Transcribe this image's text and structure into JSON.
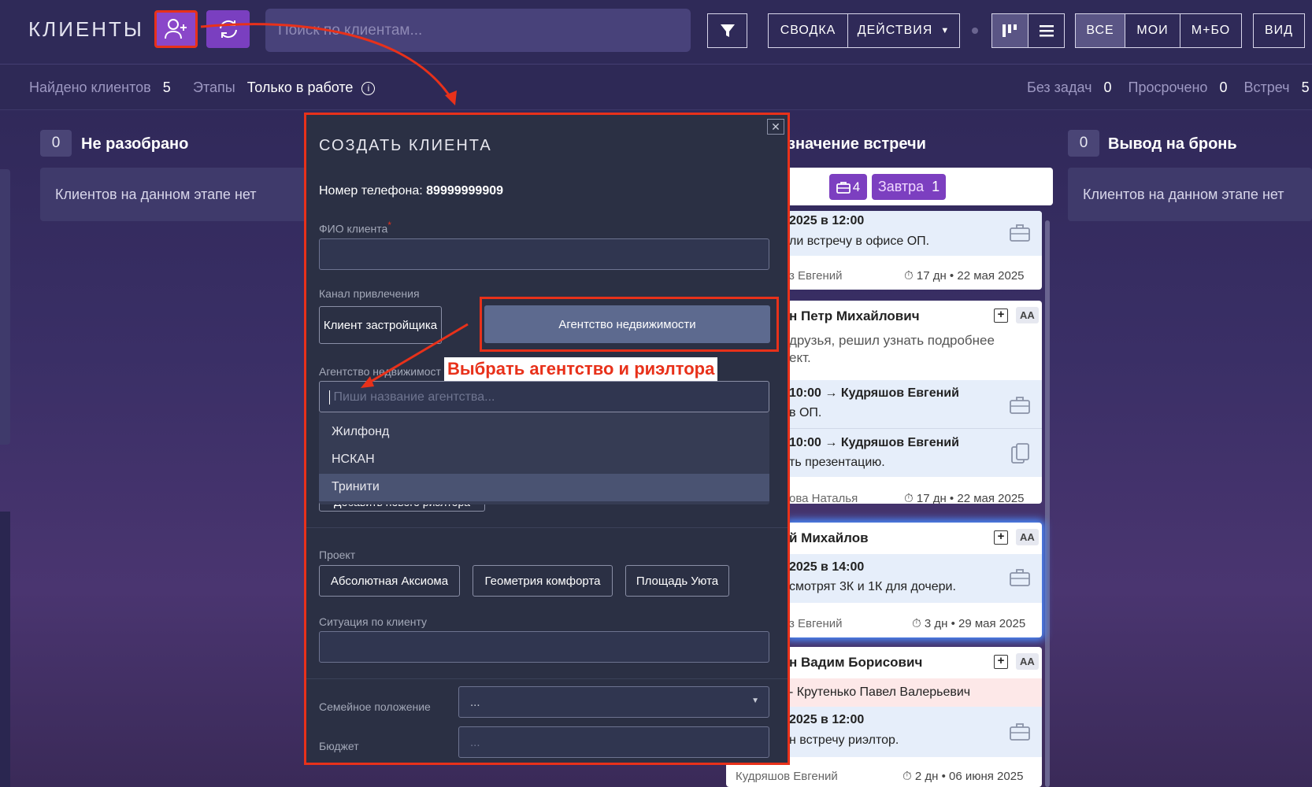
{
  "header": {
    "title": "КЛИЕНТЫ",
    "search_placeholder": "Поиск по клиентам...",
    "summary_label": "СВОДКА",
    "actions_label": "ДЕЙСТВИЯ",
    "filter_all": "ВСЕ",
    "filter_mine": "МОИ",
    "filter_mbo": "М+БО",
    "view_label": "ВИД"
  },
  "subbar": {
    "found_label": "Найдено клиентов",
    "found_count": "5",
    "stages_label": "Этапы",
    "stages_value": "Только в работе",
    "no_tasks_label": "Без задач",
    "no_tasks_count": "0",
    "overdue_label": "Просрочено",
    "overdue_count": "0",
    "meetings_label": "Встреч",
    "meetings_count": "5"
  },
  "columns": {
    "left": {
      "count": "0",
      "title": "Не разобрано",
      "empty": "Клиентов на данном этапе нет"
    },
    "middle": {
      "title": "значение встречи",
      "badge_count": "4",
      "tomorrow_label": "Завтра",
      "tomorrow_count": "1"
    },
    "right": {
      "count": "0",
      "title": "Вывод на бронь",
      "empty": "Клиентов на данном этапе нет"
    }
  },
  "cards": [
    {
      "line1": "2025 в 12:00",
      "line2": "ли встречу в офисе ОП.",
      "footer_name": "з Евгений",
      "footer_meta": "17 дн • 22 мая 2025"
    },
    {
      "name": "н Петр Михайлович",
      "tag": "АА",
      "note1": "друзья, решил узнать подробнее",
      "note2": "ект.",
      "task1": "10:00 → Кудряшов Евгений",
      "task1b": "в ОП.",
      "task2": "10:00 → Кудряшов Евгений",
      "task2b": "ть презентацию.",
      "footer_name": "ова Наталья",
      "footer_meta": "17 дн • 22 мая 2025"
    },
    {
      "name": "й Михайлов",
      "tag": "АА",
      "line1": "2025 в 14:00",
      "line2": "смотрят 3К и 1К для дочери.",
      "footer_name": "з Евгений",
      "footer_meta": "3 дн • 29 мая 2025"
    },
    {
      "name": "н Вадим Борисович",
      "tag": "АА",
      "agent": "- Крутенько Павел Валерьевич",
      "line1": "2025 в 12:00",
      "line2": "н встречу риэлтор.",
      "footer_name": "Кудряшов Евгений",
      "footer_meta": "2 дн • 06 июня 2025"
    }
  ],
  "modal": {
    "title": "СОЗДАТЬ КЛИЕНТА",
    "phone_label": "Номер телефона:",
    "phone_value": "89999999909",
    "fio_label": "ФИО клиента",
    "required_mark": "*",
    "channel_label": "Канал привлечения",
    "channel_developer": "Клиент застройщика",
    "channel_agency": "Агентство недвижимости",
    "agency_label": "Агентство недвижимост",
    "agency_placeholder": "Пиши название агентства...",
    "agency_options": [
      "Жилфонд",
      "НСКАН",
      "Тринити"
    ],
    "add_realtor_label": "Добавить нового риэлтора",
    "project_label": "Проект",
    "projects": [
      "Абсолютная Аксиома",
      "Геометрия комфорта",
      "Площадь Уюта"
    ],
    "situation_label": "Ситуация по клиенту",
    "family_label": "Семейное положение",
    "family_value": "...",
    "budget_label": "Бюджет",
    "budget_placeholder": "..."
  },
  "annotation": {
    "text": "Выбрать агентство и риэлтора"
  },
  "colors": {
    "accent_red": "#e8311a",
    "add_button": "#8a47c9",
    "sync_button": "#7a3fc0",
    "agency_selected": "#5d6a8f"
  }
}
